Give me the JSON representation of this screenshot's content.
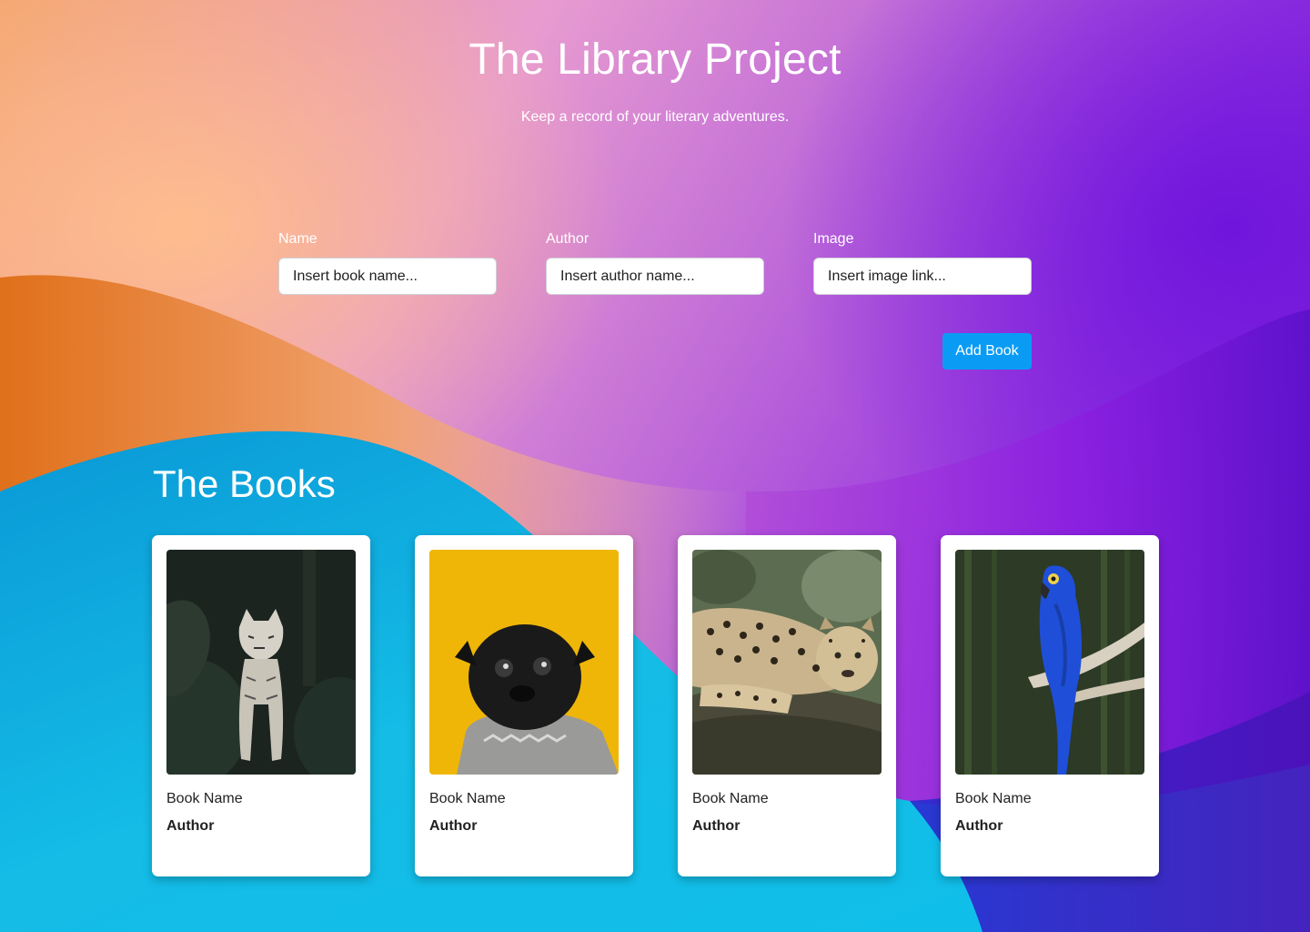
{
  "header": {
    "title": "The Library Project",
    "subtitle": "Keep a record of your literary adventures."
  },
  "form": {
    "name": {
      "label": "Name",
      "placeholder": "Insert book name..."
    },
    "author": {
      "label": "Author",
      "placeholder": "Insert author name..."
    },
    "image": {
      "label": "Image",
      "placeholder": "Insert image link..."
    },
    "submit_label": "Add Book"
  },
  "books_section": {
    "title": "The Books",
    "books": [
      {
        "name": "Book Name",
        "author": "Author",
        "image": "white-tiger-photo"
      },
      {
        "name": "Book Name",
        "author": "Author",
        "image": "pug-in-sweater-photo"
      },
      {
        "name": "Book Name",
        "author": "Author",
        "image": "leopard-photo"
      },
      {
        "name": "Book Name",
        "author": "Author",
        "image": "blue-macaw-photo"
      }
    ]
  },
  "colors": {
    "button": "#0a9cf5",
    "card": "#ffffff",
    "text": "#222222"
  }
}
